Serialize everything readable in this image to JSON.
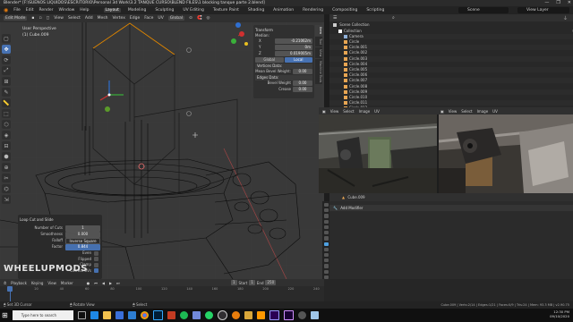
{
  "window": {
    "title": "Blender* [F:\\SUENOS LIQUIDOS\\ESCRITORIO\\Personal 3d Work\\3.2 TANQUE CURSO\\BLEND FILES\\1 blocking tanque parte 2.blend]",
    "controls": [
      "—",
      "❐",
      "✕"
    ]
  },
  "menubar": {
    "menus": [
      "File",
      "Edit",
      "Render",
      "Window",
      "Help"
    ],
    "workspaces": [
      "Layout",
      "Modeling",
      "Sculpting",
      "UV Editing",
      "Texture Paint",
      "Shading",
      "Animation",
      "Rendering",
      "Compositing",
      "Scripting"
    ],
    "active_workspace": "Layout",
    "scene": "Scene",
    "view_layer": "View Layer"
  },
  "viewport": {
    "mode": "Edit Mode",
    "menus": [
      "View",
      "Select",
      "Add",
      "Mesh",
      "Vertex",
      "Edge",
      "Face",
      "UV"
    ],
    "orientation": "Global",
    "perspective_label": "User Perspective",
    "object_label": "(1) Cube.009",
    "tools": [
      "▢",
      "✥",
      "⟳",
      "⤢",
      "⊞",
      "✎",
      "📏",
      "⬚",
      "⬡",
      "◈",
      "⊟",
      "⬢",
      "⊕",
      "✂",
      "⌬",
      "⇲"
    ],
    "active_tool_index": 1
  },
  "npanel": {
    "header": "Transform",
    "median_label": "Median:",
    "rows": [
      {
        "axis": "X",
        "value": "-0.21062m"
      },
      {
        "axis": "Y",
        "value": "0m"
      },
      {
        "axis": "Z",
        "value": "0.019005m"
      }
    ],
    "space_options": [
      "Global",
      "Local"
    ],
    "space_active": "Local",
    "vertices_data_header": "Vertices Data:",
    "mean_bevel_weight_label": "Mean Bevel Weight:",
    "mean_bevel_weight_value": "0.00",
    "edges_data_header": "Edges Data:",
    "bevel_weight_label": "Bevel Weight",
    "bevel_weight_value": "0.00",
    "crease_label": "Crease",
    "crease_value": "0.00",
    "tabs": [
      "Item",
      "Tool",
      "View",
      "Machine Tools"
    ],
    "active_tab": "Item"
  },
  "operator": {
    "title": "Loop Cut and Slide",
    "fields": [
      {
        "label": "Number of Cuts",
        "value": "1"
      },
      {
        "label": "Smoothness",
        "value": "0.000"
      },
      {
        "label": "Falloff",
        "value": "Inverse Square"
      },
      {
        "label": "Factor",
        "value": "0.844"
      }
    ],
    "checks": [
      "Even",
      "Flipped",
      "Clamp",
      "Correct UVs"
    ]
  },
  "watermark": "WHEELUPMODS",
  "outliner": {
    "title": "Scene Collection",
    "items": [
      {
        "name": "Collection",
        "color": "#ffffff",
        "indent": 1
      },
      {
        "name": "Camera",
        "color": "#8fb0d8",
        "indent": 2
      },
      {
        "name": "Circle",
        "color": "#e7a552",
        "indent": 2
      },
      {
        "name": "Circle.001",
        "color": "#e7a552",
        "indent": 2
      },
      {
        "name": "Circle.002",
        "color": "#e7a552",
        "indent": 2
      },
      {
        "name": "Circle.003",
        "color": "#e7a552",
        "indent": 2
      },
      {
        "name": "Circle.004",
        "color": "#e7a552",
        "indent": 2
      },
      {
        "name": "Circle.005",
        "color": "#e7a552",
        "indent": 2
      },
      {
        "name": "Circle.006",
        "color": "#e7a552",
        "indent": 2
      },
      {
        "name": "Circle.007",
        "color": "#e7a552",
        "indent": 2
      },
      {
        "name": "Circle.008",
        "color": "#e7a552",
        "indent": 2
      },
      {
        "name": "Circle.009",
        "color": "#e7a552",
        "indent": 2
      },
      {
        "name": "Circle.010",
        "color": "#e7a552",
        "indent": 2
      },
      {
        "name": "Circle.011",
        "color": "#e7a552",
        "indent": 2
      },
      {
        "name": "Circle.012",
        "color": "#e7a552",
        "indent": 2
      },
      {
        "name": "Circle.013",
        "color": "#e7a552",
        "indent": 2
      }
    ]
  },
  "image_editor": {
    "menus": [
      "View",
      "Select",
      "Image",
      "UV"
    ]
  },
  "properties": {
    "object_name": "Cube.009",
    "add_modifier": "Add Modifier"
  },
  "timeline": {
    "playback": "Playback",
    "keying": "Keying",
    "view": "View",
    "marker": "Marker",
    "current_frame": "1",
    "start_label": "Start",
    "start": "1",
    "end_label": "End",
    "end": "250",
    "ticks": [
      "0",
      "20",
      "40",
      "60",
      "80",
      "100",
      "120",
      "140",
      "160",
      "180",
      "200",
      "220",
      "240"
    ]
  },
  "statusbar": {
    "left": "Set 3D Cursor",
    "mid1": "Rotate View",
    "mid2": "Select",
    "right": "Cube.009 | Verts:2/14 | Edges:1/21 | Faces:0/9 | Tris:24 | Mem: 93.3 MB | v2.90.75"
  },
  "taskbar": {
    "search_placeholder": "Type here to search",
    "time": "12:30 PM",
    "date": "09/10/2020"
  },
  "colors": {
    "accent": "#4772b3",
    "selected_row": "#334d80",
    "active_object": "#ffa020"
  }
}
